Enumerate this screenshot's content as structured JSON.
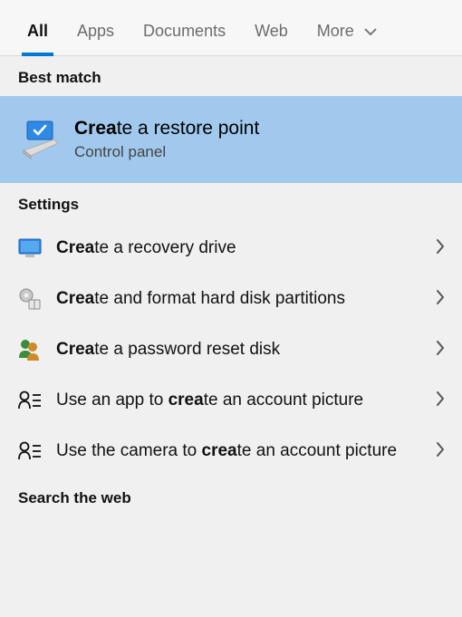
{
  "tabs": {
    "all": "All",
    "apps": "Apps",
    "documents": "Documents",
    "web": "Web",
    "more": "More",
    "active": "all"
  },
  "sections": {
    "best_match": "Best match",
    "settings": "Settings",
    "search_web": "Search the web"
  },
  "best_match": {
    "title_bold": "Crea",
    "title_rest": "te a restore point",
    "subtitle": "Control panel"
  },
  "settings_results": [
    {
      "icon": "monitor-blue",
      "bold": "Crea",
      "rest": "te a recovery drive"
    },
    {
      "icon": "gear-partition",
      "bold": "Crea",
      "rest": "te and format hard disk partitions"
    },
    {
      "icon": "users-key",
      "bold": "Crea",
      "rest": "te a password reset disk"
    },
    {
      "icon": "person-list",
      "pre": "Use an app to ",
      "bold": "crea",
      "rest": "te an account picture"
    },
    {
      "icon": "person-list",
      "pre": "Use the camera to ",
      "bold": "crea",
      "rest": "te an account picture"
    }
  ]
}
